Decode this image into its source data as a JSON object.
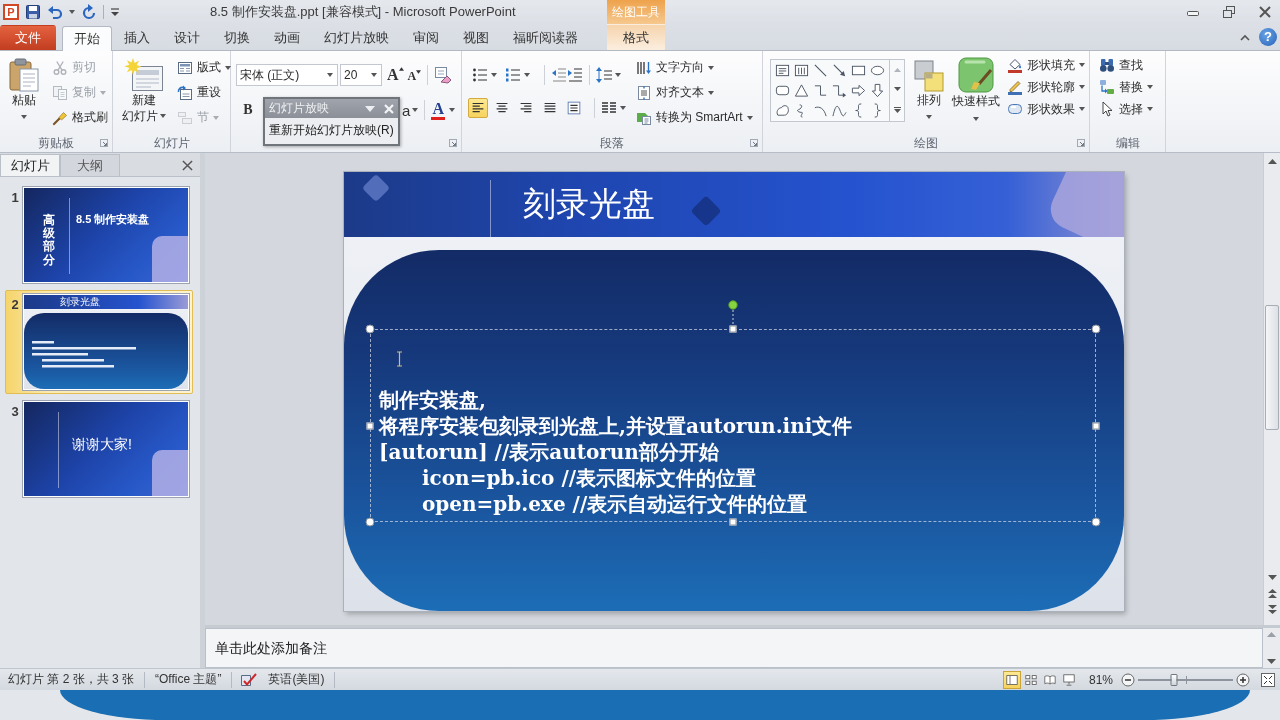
{
  "window": {
    "app_logo": "P",
    "title": "8.5 制作安装盘.ppt [兼容模式] - Microsoft PowerPoint",
    "context_header": "绘图工具",
    "help": "?"
  },
  "tabs": [
    {
      "label": "文件",
      "kind": "file",
      "selected": false
    },
    {
      "label": "开始",
      "kind": "normal",
      "selected": true
    },
    {
      "label": "插入",
      "kind": "normal",
      "selected": false
    },
    {
      "label": "设计",
      "kind": "normal",
      "selected": false
    },
    {
      "label": "切换",
      "kind": "normal",
      "selected": false
    },
    {
      "label": "动画",
      "kind": "normal",
      "selected": false
    },
    {
      "label": "幻灯片放映",
      "kind": "normal",
      "selected": false
    },
    {
      "label": "审阅",
      "kind": "normal",
      "selected": false
    },
    {
      "label": "视图",
      "kind": "normal",
      "selected": false
    },
    {
      "label": "福昕阅读器",
      "kind": "normal",
      "selected": false
    },
    {
      "label": "格式",
      "kind": "context",
      "selected": false
    }
  ],
  "ribbon": {
    "clipboard": {
      "label": "剪贴板",
      "paste": "粘贴",
      "commands": [
        {
          "kind": "cut",
          "label": "剪切",
          "disabled": true,
          "dropdown": false
        },
        {
          "kind": "copy",
          "label": "复制",
          "disabled": true,
          "dropdown": true
        },
        {
          "kind": "painter",
          "label": "格式刷",
          "disabled": false,
          "dropdown": false
        }
      ]
    },
    "slides": {
      "label": "幻灯片",
      "new_slide": [
        "新建",
        "幻灯片"
      ],
      "commands": [
        {
          "kind": "layout",
          "label": "版式",
          "disabled": false,
          "dropdown": true
        },
        {
          "kind": "reset",
          "label": "重设",
          "disabled": false,
          "dropdown": false
        },
        {
          "kind": "section",
          "label": "节",
          "disabled": true,
          "dropdown": true
        }
      ]
    },
    "font": {
      "font_name": "宋体 (正文)",
      "font_size": "20",
      "grow": "A",
      "shrink": "A",
      "bold": "B",
      "change_case": "a",
      "font_color": "A"
    },
    "paragraph": {
      "label": "段落",
      "alignment": [
        {
          "kind": "left",
          "selected": true
        },
        {
          "kind": "center",
          "selected": false
        },
        {
          "kind": "right",
          "selected": false
        },
        {
          "kind": "justify",
          "selected": false
        },
        {
          "kind": "distributed",
          "selected": false
        }
      ],
      "commands": [
        {
          "kind": "direction",
          "label": "文字方向",
          "disabled": false,
          "dropdown": true
        },
        {
          "kind": "align",
          "label": "对齐文本",
          "disabled": false,
          "dropdown": true
        },
        {
          "kind": "smartart",
          "label": "转换为 SmartArt",
          "disabled": false,
          "dropdown": true
        }
      ]
    },
    "drawing": {
      "label": "绘图",
      "arrange": "排列",
      "quick_styles": "快速样式",
      "commands": [
        {
          "kind": "fill",
          "label": "形状填充",
          "disabled": false,
          "dropdown": true
        },
        {
          "kind": "outline",
          "label": "形状轮廓",
          "disabled": false,
          "dropdown": true
        },
        {
          "kind": "effects",
          "label": "形状效果",
          "disabled": false,
          "dropdown": true
        }
      ]
    },
    "editing": {
      "label": "编辑",
      "commands": [
        {
          "kind": "find",
          "label": "查找",
          "disabled": false,
          "dropdown": false
        },
        {
          "kind": "replace",
          "label": "替换",
          "disabled": false,
          "dropdown": true
        },
        {
          "kind": "select",
          "label": "选择",
          "disabled": false,
          "dropdown": true
        }
      ]
    }
  },
  "floating_toolbar": {
    "title": "幻灯片放映",
    "button": "重新开始幻灯片放映(R)"
  },
  "slide_pane": {
    "tabs": [
      {
        "label": "幻灯片",
        "selected": true
      },
      {
        "label": "大纲",
        "selected": false
      }
    ],
    "thumbnails": [
      {
        "number": "1",
        "kind": "title",
        "selected": false,
        "title": "8.5 制作安装盘",
        "side_text": "高级部分"
      },
      {
        "number": "2",
        "kind": "content",
        "selected": true,
        "title": "刻录光盘"
      },
      {
        "number": "3",
        "kind": "closing",
        "selected": false,
        "title": "谢谢大家!"
      }
    ]
  },
  "slide": {
    "title": "刻录光盘",
    "text_box": {
      "selected": true,
      "paragraphs": [
        {
          "text": "制作安装盘,"
        },
        {
          "text": "将程序安装包刻录到光盘上,并设置autorun.ini文件"
        },
        {
          "text": "[autorun] //表示autorun部分开始",
          "children": [
            {
              "text": "icon=pb.ico //表示图标文件的位置"
            },
            {
              "text": "open=pb.exe //表示自动运行文件的位置"
            }
          ]
        }
      ]
    }
  },
  "notes": {
    "placeholder": "单击此处添加备注"
  },
  "status_bar": {
    "slide_info": "幻灯片 第 2 张，共 3 张",
    "theme": "“Office 主题”",
    "language": "英语(美国)",
    "views": [
      {
        "kind": "normal",
        "selected": true
      },
      {
        "kind": "sorter",
        "selected": false
      },
      {
        "kind": "reading",
        "selected": false
      },
      {
        "kind": "slideshow",
        "selected": false
      }
    ],
    "zoom": "81%",
    "zoom_slider": {
      "level": 0.38
    }
  }
}
